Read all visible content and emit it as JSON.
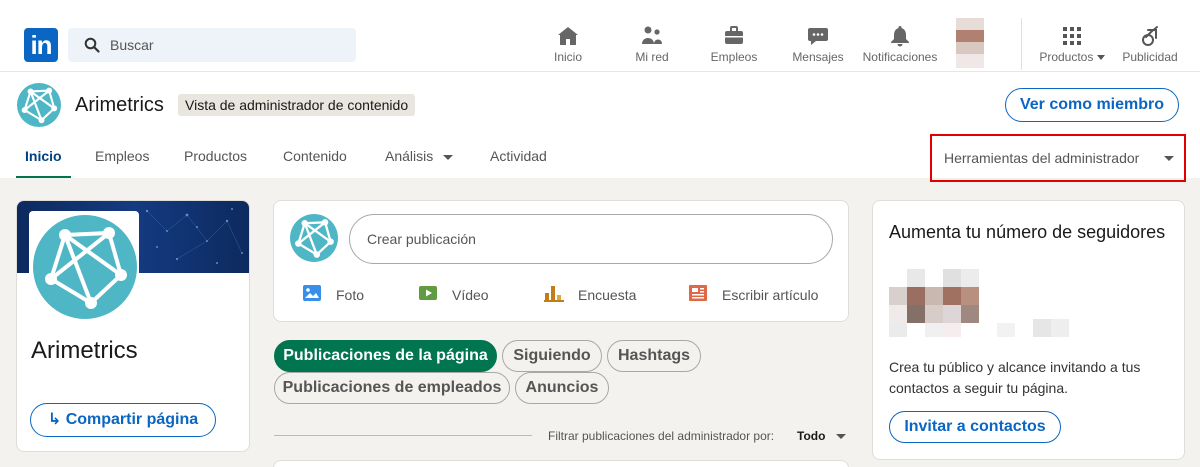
{
  "nav": {
    "search_placeholder": "Buscar",
    "items": [
      {
        "label": "Inicio",
        "icon": "home-icon"
      },
      {
        "label": "Mi red",
        "icon": "network-icon"
      },
      {
        "label": "Empleos",
        "icon": "briefcase-icon"
      },
      {
        "label": "Mensajes",
        "icon": "messaging-icon"
      },
      {
        "label": "Notificaciones",
        "icon": "bell-icon"
      }
    ],
    "products_label": "Productos",
    "advertise_label": "Publicidad"
  },
  "company": {
    "name": "Arimetrics",
    "admin_badge": "Vista de administrador de contenido",
    "view_as_member": "Ver como miembro"
  },
  "tabs": [
    {
      "label": "Inicio",
      "active": true
    },
    {
      "label": "Empleos"
    },
    {
      "label": "Productos"
    },
    {
      "label": "Contenido"
    },
    {
      "label": "Análisis",
      "dropdown": true
    },
    {
      "label": "Actividad"
    }
  ],
  "admin_tools": {
    "label": "Herramientas del administrador"
  },
  "left_card": {
    "name": "Arimetrics",
    "share_label": "Compartir página"
  },
  "composer": {
    "placeholder": "Crear publicación",
    "actions": [
      {
        "label": "Foto",
        "icon": "photo-icon",
        "color": "#378fe9"
      },
      {
        "label": "Vídeo",
        "icon": "video-icon",
        "color": "#5f9b41"
      },
      {
        "label": "Encuesta",
        "icon": "poll-icon",
        "color": "#c37d16"
      },
      {
        "label": "Escribir artículo",
        "icon": "article-icon",
        "color": "#e06847"
      }
    ]
  },
  "filters": {
    "pills": [
      {
        "label": "Publicaciones de la página",
        "active": true
      },
      {
        "label": "Siguiendo"
      },
      {
        "label": "Hashtags"
      },
      {
        "label": "Publicaciones de empleados"
      },
      {
        "label": "Anuncios"
      }
    ],
    "admin_filter_label": "Filtrar publicaciones del administrador por:",
    "admin_filter_value": "Todo"
  },
  "right_card": {
    "title": "Aumenta tu número de seguidores",
    "description": "Crea tu público y alcance invitando a tus contactos a seguir tu página.",
    "invite_label": "Invitar a contactos"
  },
  "colors": {
    "brand": "#0a66c2",
    "active_green": "#01754f",
    "highlight_red": "#e00000",
    "logo_teal": "#4fb6c6"
  }
}
